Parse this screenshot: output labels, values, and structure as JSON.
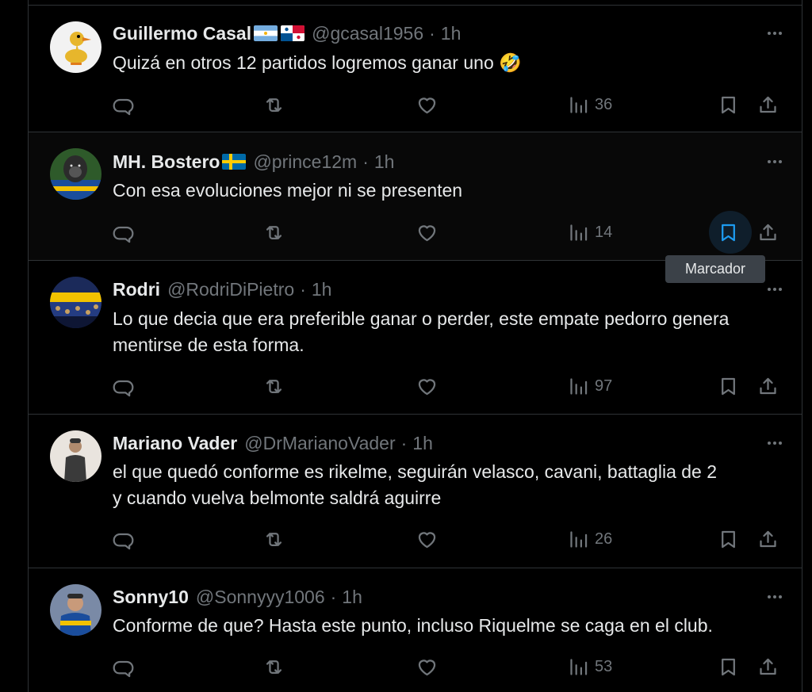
{
  "tooltip": "Marcador",
  "tweets": [
    {
      "name": "Guillermo Casal",
      "flags": [
        "argentina",
        "panama"
      ],
      "handle": "@gcasal1956",
      "time": "1h",
      "text": "Quizá en otros 12 partidos logremos ganar uno 🤣",
      "views": "36",
      "avatar": "duck-avatar"
    },
    {
      "name": "MH. Bostero",
      "flags": [
        "sweden"
      ],
      "handle": "@prince12m",
      "time": "1h",
      "text": "Con esa evoluciones mejor ni se presenten",
      "views": "14",
      "avatar": "gorilla-avatar"
    },
    {
      "name": "Rodri",
      "flags": [],
      "handle": "@RodriDiPietro",
      "time": "1h",
      "text_line1": "Lo que decia que era preferible ganar o perder, este empate pedorro genera",
      "text_line2": "mentirse de esta forma.",
      "views": "97",
      "avatar": "stadium-crowd-avatar"
    },
    {
      "name": "Mariano Vader",
      "flags": [],
      "handle": "@DrMarianoVader",
      "time": "1h",
      "text_line1": "el que quedó conforme es rikelme, seguirán velasco, cavani, battaglia de 2",
      "text_line2": "y cuando vuelva belmonte saldrá aguirre",
      "views": "26",
      "avatar": "man-portrait-avatar"
    },
    {
      "name": "Sonny10",
      "flags": [],
      "handle": "@Sonnyyy1006",
      "time": "1h",
      "text": "Conforme de que? Hasta este punto, incluso Riquelme se caga en el club.",
      "views": "53",
      "avatar": "player-avatar"
    }
  ],
  "colors": {
    "background": "#000000",
    "text_primary": "#e7e9ea",
    "text_secondary": "#71767b",
    "accent": "#1d9bf0",
    "border": "#2f3336"
  }
}
